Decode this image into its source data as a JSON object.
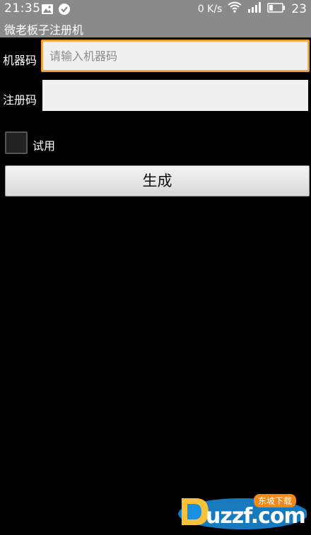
{
  "status_bar": {
    "time": "21:35",
    "speed": "0 K/s",
    "battery_level": "23",
    "icons": [
      "image-icon",
      "check-circle-icon",
      "wifi-icon",
      "signal-icon",
      "battery-icon"
    ]
  },
  "app": {
    "title": "微老板子注册机"
  },
  "form": {
    "machine_code_label": "机器码",
    "machine_code_placeholder": "请输入机器码",
    "machine_code_value": "",
    "reg_code_label": "注册码",
    "reg_code_value": "",
    "trial_label": "试用",
    "trial_checked": false,
    "generate_label": "生成"
  },
  "watermark": {
    "text": "uzzf.com",
    "badge": "东坡下载"
  },
  "colors": {
    "status_bar_bg": "#8a8a8a",
    "background": "#000000",
    "input_bg": "#f0f0f0",
    "focus_accent": "#f39c2c",
    "watermark_accent": "#1b8fe0"
  }
}
